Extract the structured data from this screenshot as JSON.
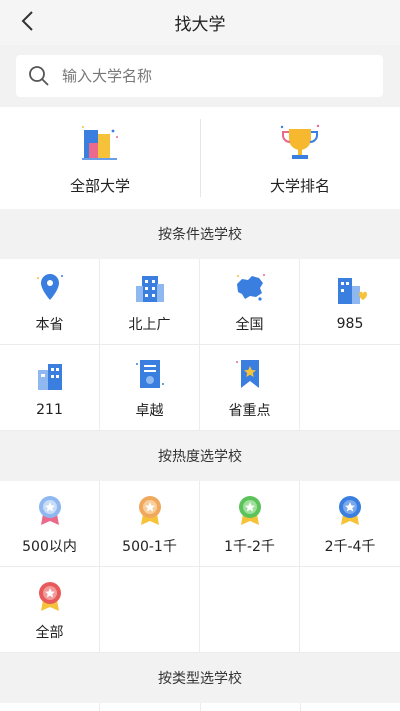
{
  "header": {
    "title": "找大学"
  },
  "search": {
    "placeholder": "输入大学名称"
  },
  "top_cards": [
    {
      "label": "全部大学",
      "icon": "building-icon"
    },
    {
      "label": "大学排名",
      "icon": "trophy-icon"
    }
  ],
  "sections": {
    "condition": {
      "title": "按条件选学校",
      "items": [
        {
          "label": "本省",
          "icon": "location-pin-icon"
        },
        {
          "label": "北上广",
          "icon": "city-buildings-icon"
        },
        {
          "label": "全国",
          "icon": "china-map-icon"
        },
        {
          "label": "985",
          "icon": "building-heart-icon"
        },
        {
          "label": "211",
          "icon": "school-building-icon"
        },
        {
          "label": "卓越",
          "icon": "document-badge-icon"
        },
        {
          "label": "省重点",
          "icon": "bookmark-star-icon"
        }
      ]
    },
    "popularity": {
      "title": "按热度选学校",
      "items": [
        {
          "label": "500以内",
          "icon": "medal-blue-icon"
        },
        {
          "label": "500-1千",
          "icon": "medal-orange-icon"
        },
        {
          "label": "1千-2千",
          "icon": "medal-green-icon"
        },
        {
          "label": "2千-4千",
          "icon": "medal-darkblue-icon"
        },
        {
          "label": "全部",
          "icon": "medal-red-icon"
        }
      ]
    },
    "type": {
      "title": "按类型选学校"
    }
  },
  "colors": {
    "accent_blue": "#3a7fe0",
    "background": "#f2f2f2"
  }
}
